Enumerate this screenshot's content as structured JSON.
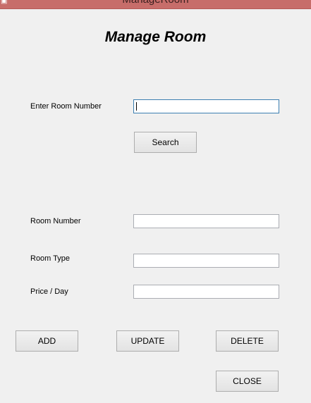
{
  "window": {
    "title": "ManageRoom"
  },
  "heading": "Manage Room",
  "search": {
    "label": "Enter Room Number",
    "value": "",
    "button_label": "Search"
  },
  "fields": {
    "room_number": {
      "label": "Room Number",
      "value": ""
    },
    "room_type": {
      "label": "Room Type",
      "value": ""
    },
    "price_per_day": {
      "label": "Price / Day",
      "value": ""
    }
  },
  "actions": {
    "add_label": "ADD",
    "update_label": "UPDATE",
    "delete_label": "DELETE",
    "close_label": "CLOSE"
  },
  "colors": {
    "titlebar": "#c76d6a",
    "background": "#f0f0f0",
    "focused_border": "#3c7fb1"
  }
}
